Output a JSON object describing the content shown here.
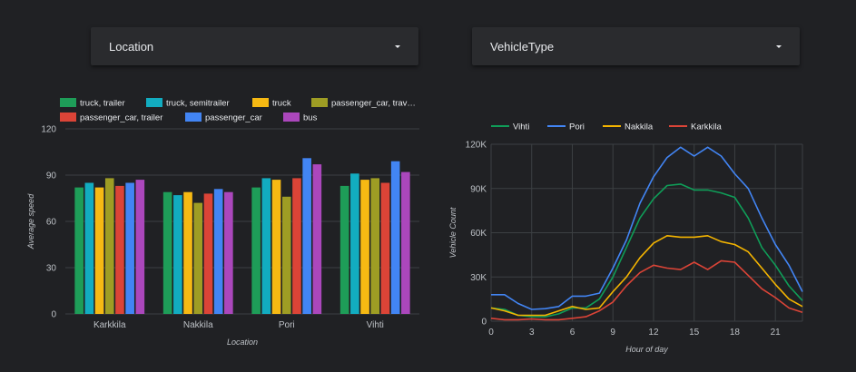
{
  "filters": {
    "location_label": "Location",
    "vehicle_type_label": "VehicleType"
  },
  "colors": {
    "background": "#202124",
    "grid": "#3c4043",
    "text": "#bdc1c6"
  },
  "chart_data": [
    {
      "type": "bar",
      "title": "",
      "xlabel": "Location",
      "ylabel": "Average speed",
      "ylim": [
        0,
        120
      ],
      "yticks": [
        0,
        30,
        60,
        90,
        120
      ],
      "legend": "top",
      "grid": true,
      "categories": [
        "Karkkila",
        "Nakkila",
        "Pori",
        "Vihti"
      ],
      "series": [
        {
          "name": "truck, trailer",
          "legend_label": "truck, trailer",
          "color": "#1e9d58",
          "values": [
            82,
            79,
            82,
            83
          ]
        },
        {
          "name": "truck, semitrailer",
          "legend_label": "truck, semitrailer",
          "color": "#12acc0",
          "values": [
            85,
            77,
            88,
            91
          ]
        },
        {
          "name": "truck",
          "legend_label": "truck",
          "color": "#f6b913",
          "values": [
            82,
            79,
            87,
            87
          ]
        },
        {
          "name": "passenger_car, travel trailer",
          "legend_label": "passenger_car, trav…",
          "color": "#9e9d24",
          "values": [
            88,
            72,
            76,
            88
          ]
        },
        {
          "name": "passenger_car, trailer",
          "legend_label": "passenger_car, trailer",
          "color": "#db4437",
          "values": [
            83,
            78,
            88,
            85
          ]
        },
        {
          "name": "passenger_car",
          "legend_label": "passenger_car",
          "color": "#4285f4",
          "values": [
            85,
            81,
            101,
            99
          ]
        },
        {
          "name": "bus",
          "legend_label": "bus",
          "color": "#ab47bc",
          "values": [
            87,
            79,
            97,
            92
          ]
        }
      ]
    },
    {
      "type": "line",
      "title": "",
      "xlabel": "Hour of day",
      "ylabel": "Vehicle Count",
      "xlim": [
        0,
        23
      ],
      "ylim": [
        0,
        120000
      ],
      "xticks": [
        0,
        3,
        6,
        9,
        12,
        15,
        18,
        21
      ],
      "yticks": [
        0,
        30000,
        60000,
        90000,
        120000
      ],
      "ytick_labels": [
        "0",
        "30K",
        "60K",
        "90K",
        "120K"
      ],
      "legend": "top",
      "grid": true,
      "x": [
        0,
        1,
        2,
        3,
        4,
        5,
        6,
        7,
        8,
        9,
        10,
        11,
        12,
        13,
        14,
        15,
        16,
        17,
        18,
        19,
        20,
        21,
        22,
        23
      ],
      "series": [
        {
          "name": "Vihti",
          "color": "#0f9d58",
          "values": [
            9000,
            8000,
            4000,
            3000,
            3000,
            5000,
            9000,
            9000,
            15000,
            30000,
            50000,
            70000,
            83000,
            92000,
            93000,
            89000,
            89000,
            87000,
            84000,
            70000,
            50000,
            38000,
            24000,
            14000
          ]
        },
        {
          "name": "Pori",
          "color": "#4285f4",
          "values": [
            18000,
            18000,
            12000,
            8000,
            8500,
            10000,
            17000,
            17000,
            19000,
            36000,
            55000,
            80000,
            98000,
            111000,
            118000,
            112000,
            118000,
            112000,
            100000,
            90000,
            70000,
            52000,
            38000,
            20000
          ]
        },
        {
          "name": "Nakkila",
          "color": "#f4b400",
          "values": [
            9000,
            7000,
            4000,
            4000,
            4000,
            7000,
            10000,
            8000,
            9000,
            20000,
            30000,
            43000,
            53000,
            58000,
            57000,
            57000,
            58000,
            54000,
            52000,
            47000,
            36000,
            25000,
            15000,
            10000
          ]
        },
        {
          "name": "Karkkila",
          "color": "#db4437",
          "values": [
            2000,
            1000,
            1000,
            1500,
            1000,
            1000,
            2000,
            3000,
            7000,
            13000,
            24000,
            33000,
            38000,
            36000,
            35000,
            40000,
            35000,
            41000,
            40000,
            31000,
            22000,
            16000,
            9000,
            6000
          ]
        }
      ]
    }
  ]
}
